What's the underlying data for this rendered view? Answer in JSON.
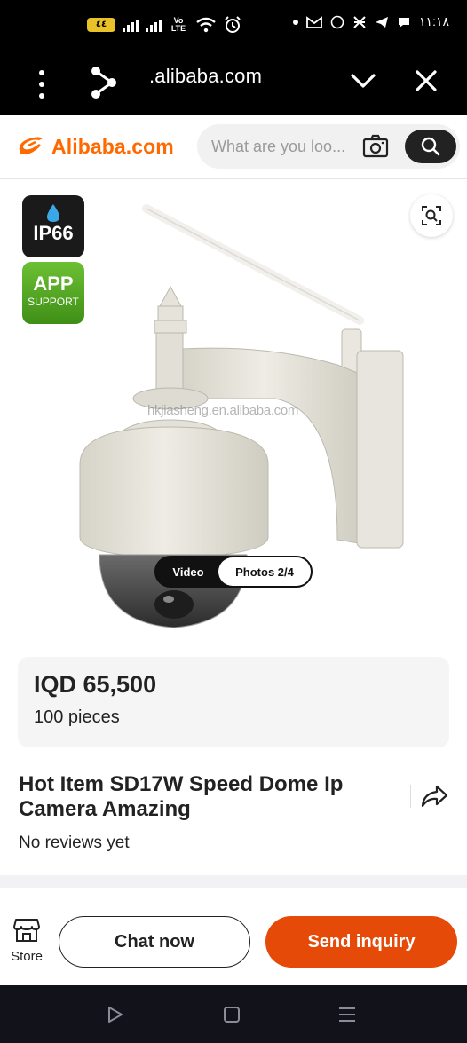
{
  "status_bar": {
    "battery": "٤٤",
    "volte": "Vo LTE",
    "time": "١١:١٨"
  },
  "browser": {
    "url": ".alibaba.com"
  },
  "header": {
    "logo_text": "Alibaba.com",
    "search_placeholder": "What are you loo...",
    "brand_color": "#ff6a00"
  },
  "product_image": {
    "badge_ip66": "IP66",
    "badge_app_title": "APP",
    "badge_app_subtitle": "SUPPORT",
    "watermark": "hkjiasheng.en.alibaba.com",
    "media_video": "Video",
    "media_photos": "Photos 2/4"
  },
  "price_card": {
    "price": "IQD 65,500",
    "moq": "100 pieces"
  },
  "product": {
    "title": "Hot Item SD17W Speed Dome Ip Camera Amazing",
    "reviews": "No reviews yet"
  },
  "actions": {
    "store_label": "Store",
    "chat_label": "Chat now",
    "inquiry_label": "Send inquiry",
    "inquiry_color": "#e64a08"
  },
  "icons": {
    "menu": "more-vertical-icon",
    "share": "share-icon",
    "chevron": "chevron-down-icon",
    "close": "close-icon",
    "camera_search": "camera-search-icon",
    "search": "search-icon",
    "zoom": "image-search-icon",
    "forward": "share-forward-icon",
    "store": "store-icon"
  }
}
